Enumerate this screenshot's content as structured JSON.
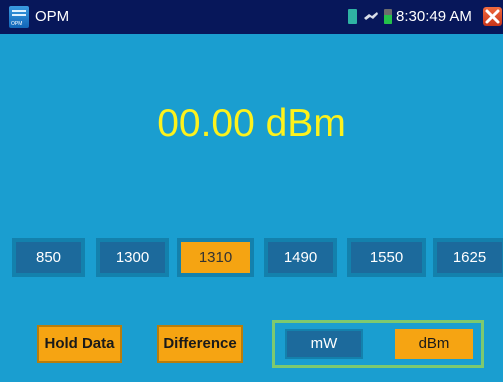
{
  "statusbar": {
    "app_title": "OPM",
    "app_icon_text": "OPM",
    "time": "8:30:49 AM",
    "icons": [
      "sd-card-icon",
      "usb-icon",
      "battery-icon",
      "close-icon"
    ],
    "battery_level_pct": 60
  },
  "display": {
    "reading": "00.00 dBm",
    "reading_color": "#fdf21c"
  },
  "wavelengths": [
    {
      "label": "850",
      "selected": false
    },
    {
      "label": "1300",
      "selected": false
    },
    {
      "label": "1310",
      "selected": true
    },
    {
      "label": "1490",
      "selected": false
    },
    {
      "label": "1550",
      "selected": false
    },
    {
      "label": "1625",
      "selected": false
    }
  ],
  "actions": {
    "hold_label": "Hold Data",
    "difference_label": "Difference"
  },
  "unit_toggle": {
    "mw_label": "mW",
    "dbm_label": "dBm",
    "selected": "dBm"
  },
  "colors": {
    "background": "#1a9ed0",
    "statusbar": "#07175a",
    "accent": "#f6a412",
    "button": "#1c6a9c"
  }
}
